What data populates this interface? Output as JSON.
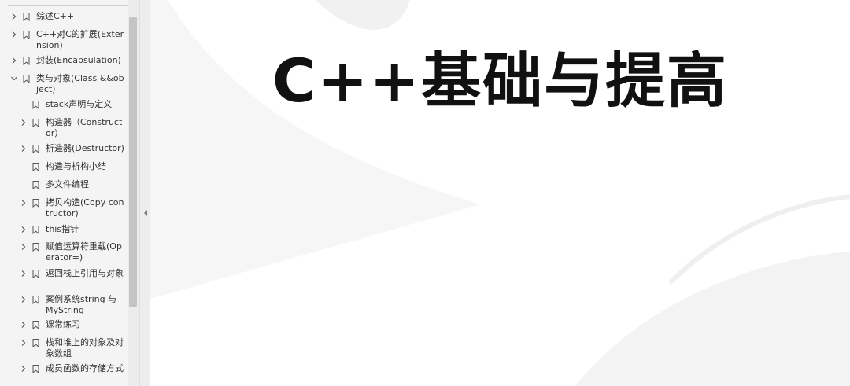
{
  "toc": {
    "items": [
      {
        "label": "综述C++",
        "level": 0,
        "expander": "right"
      },
      {
        "label": "C++对C的扩展(Externsion)",
        "level": 0,
        "expander": "right"
      },
      {
        "label": "封装(Encapsulation)",
        "level": 0,
        "expander": "right"
      },
      {
        "label": "类与对象(Class &&object)",
        "level": 0,
        "expander": "down"
      },
      {
        "label": "stack声明与定义",
        "level": 1,
        "expander": "none"
      },
      {
        "label": "构造器（Constructor）",
        "level": 1,
        "expander": "right"
      },
      {
        "label": "析造器(Destructor)",
        "level": 1,
        "expander": "right"
      },
      {
        "label": "构造与析构小结",
        "level": 1,
        "expander": "none"
      },
      {
        "label": "多文件编程",
        "level": 1,
        "expander": "none"
      },
      {
        "label": "拷贝构造(Copy contructor)",
        "level": 1,
        "expander": "right"
      },
      {
        "label": "this指针",
        "level": 1,
        "expander": "right"
      },
      {
        "label": "赋值运算符重载(Operator=)",
        "level": 1,
        "expander": "right"
      },
      {
        "label": "返回栈上引用与对象",
        "level": 1,
        "expander": "right"
      },
      {
        "label": "案例系统string 与 MyString",
        "level": 1,
        "expander": "right"
      },
      {
        "label": "课常练习",
        "level": 1,
        "expander": "right"
      },
      {
        "label": "栈和堆上的对象及对象数组",
        "level": 1,
        "expander": "right"
      },
      {
        "label": "成员函数的存储方式",
        "level": 1,
        "expander": "right"
      }
    ]
  },
  "document": {
    "title": "C++基础与提高"
  },
  "colors": {
    "sidebar_bg": "#f4f4f4",
    "text": "#333333",
    "title": "#111111",
    "scroll_thumb": "#c4c4c4"
  },
  "icons": {
    "expand": "chevron-right-icon",
    "collapse": "chevron-down-icon",
    "bookmark": "bookmark-icon",
    "collapse_sidebar": "triangle-left-icon"
  }
}
